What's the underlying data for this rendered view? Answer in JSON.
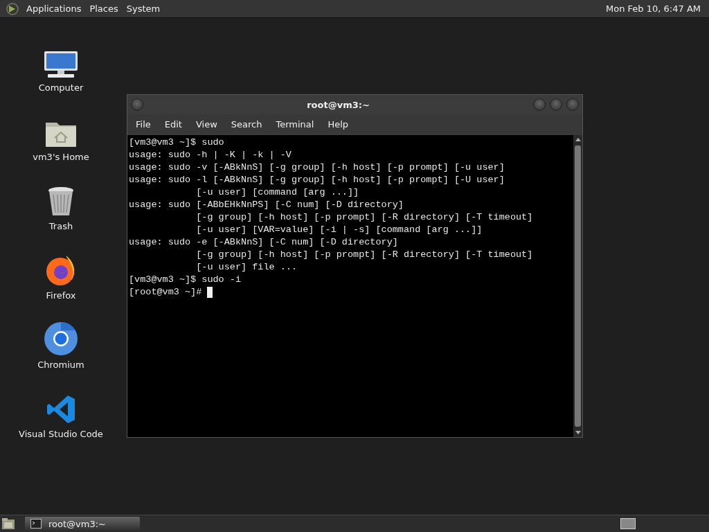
{
  "top_panel": {
    "menus": [
      "Applications",
      "Places",
      "System"
    ],
    "clock": "Mon Feb 10,  6:47 AM"
  },
  "desktop_icons": [
    {
      "kind": "computer",
      "label": "Computer"
    },
    {
      "kind": "home",
      "label": "vm3's Home"
    },
    {
      "kind": "trash",
      "label": "Trash"
    },
    {
      "kind": "firefox",
      "label": "Firefox"
    },
    {
      "kind": "chromium",
      "label": "Chromium"
    },
    {
      "kind": "vscode",
      "label": "Visual Studio Code"
    }
  ],
  "terminal": {
    "title": "root@vm3:~",
    "menu": [
      "File",
      "Edit",
      "View",
      "Search",
      "Terminal",
      "Help"
    ],
    "lines": [
      "[vm3@vm3 ~]$ sudo",
      "usage: sudo -h | -K | -k | -V",
      "usage: sudo -v [-ABkNnS] [-g group] [-h host] [-p prompt] [-u user]",
      "usage: sudo -l [-ABkNnS] [-g group] [-h host] [-p prompt] [-U user]",
      "            [-u user] [command [arg ...]]",
      "usage: sudo [-ABbEHkNnPS] [-C num] [-D directory]",
      "            [-g group] [-h host] [-p prompt] [-R directory] [-T timeout]",
      "            [-u user] [VAR=value] [-i | -s] [command [arg ...]]",
      "usage: sudo -e [-ABkNnS] [-C num] [-D directory]",
      "            [-g group] [-h host] [-p prompt] [-R directory] [-T timeout]",
      "            [-u user] file ...",
      "[vm3@vm3 ~]$ sudo -i",
      "[root@vm3 ~]# "
    ],
    "cursor": true
  },
  "taskbar": {
    "tasks": [
      {
        "label": "root@vm3:~",
        "selected": true
      }
    ]
  }
}
